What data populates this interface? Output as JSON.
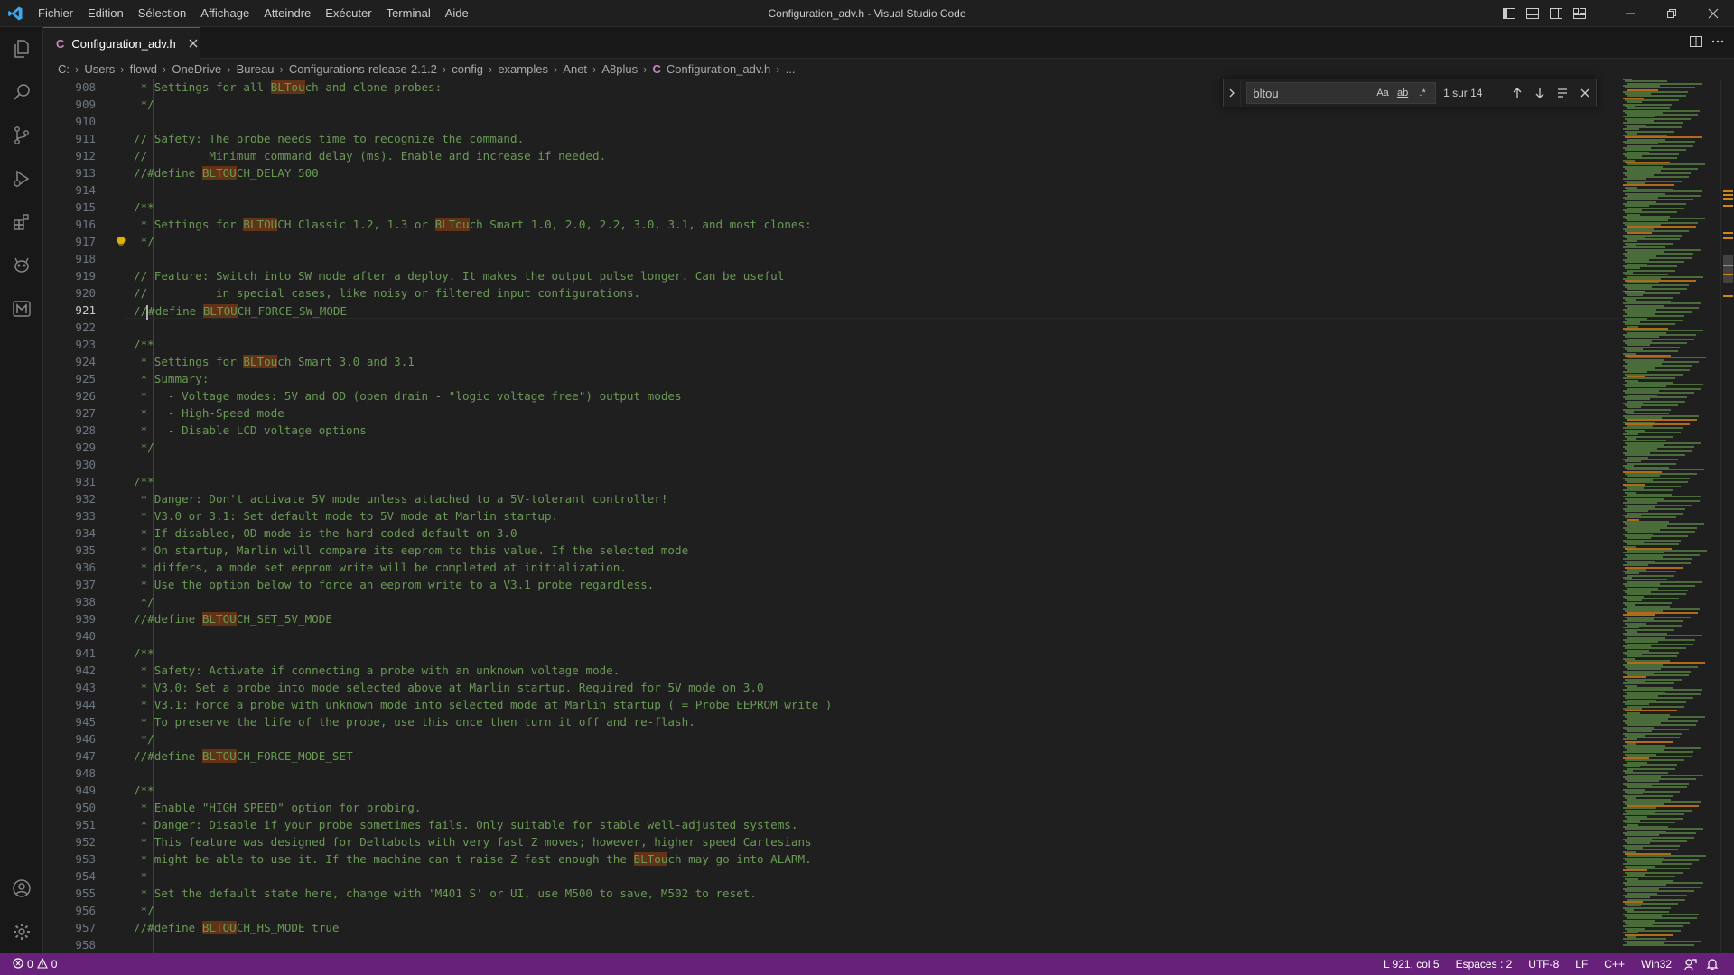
{
  "window": {
    "title": "Configuration_adv.h - Visual Studio Code",
    "menu": [
      "Fichier",
      "Edition",
      "Sélection",
      "Affichage",
      "Atteindre",
      "Exécuter",
      "Terminal",
      "Aide"
    ]
  },
  "tab": {
    "lang": "C",
    "label": "Configuration_adv.h"
  },
  "breadcrumb": {
    "items": [
      "C:",
      "Users",
      "flowd",
      "OneDrive",
      "Bureau",
      "Configurations-release-2.1.2",
      "config",
      "examples",
      "Anet",
      "A8plus"
    ],
    "file_lang": "C",
    "file": "Configuration_adv.h",
    "more": "..."
  },
  "find": {
    "value": "bltou",
    "match_case": "Aa",
    "whole_word": "ab",
    "regex": ".*",
    "count": "1 sur 14"
  },
  "editor": {
    "active_line": 921,
    "lines": [
      {
        "n": 908,
        "t": " * Settings for all ",
        "m": [
          "BLTou",
          "ch and clone probes:"
        ]
      },
      {
        "n": 909,
        "t": " */"
      },
      {
        "n": 910,
        "t": ""
      },
      {
        "n": 911,
        "t": "// Safety: The probe needs time to recognize the command."
      },
      {
        "n": 912,
        "t": "//         Minimum command delay (ms). Enable and increase if needed."
      },
      {
        "n": 913,
        "t": "//#define ",
        "m": [
          "BLTOU",
          "CH_DELAY 500"
        ]
      },
      {
        "n": 914,
        "t": ""
      },
      {
        "n": 915,
        "t": "/**"
      },
      {
        "n": 916,
        "t": " * Settings for ",
        "m": [
          "BLTOU",
          "CH Classic 1.2, 1.3 or ",
          "BLTou",
          "ch Smart 1.0, 2.0, 2.2, 3.0, 3.1, and most clones:"
        ]
      },
      {
        "n": 917,
        "t": " */"
      },
      {
        "n": 918,
        "t": ""
      },
      {
        "n": 919,
        "t": "// Feature: Switch into SW mode after a deploy. It makes the output pulse longer. Can be useful"
      },
      {
        "n": 920,
        "t": "//          in special cases, like noisy or filtered input configurations."
      },
      {
        "n": 921,
        "t": "//",
        "cursor": true,
        "m": [
          "",
          "#define "
        ],
        "m2": [
          "BLTOU",
          "CH_FORCE_SW_MODE"
        ]
      },
      {
        "n": 922,
        "t": ""
      },
      {
        "n": 923,
        "t": "/**"
      },
      {
        "n": 924,
        "t": " * Settings for ",
        "m": [
          "BLTou",
          "ch Smart 3.0 and 3.1"
        ]
      },
      {
        "n": 925,
        "t": " * Summary:"
      },
      {
        "n": 926,
        "t": " *   - Voltage modes: 5V and OD (open drain - \"logic voltage free\") output modes"
      },
      {
        "n": 927,
        "t": " *   - High-Speed mode"
      },
      {
        "n": 928,
        "t": " *   - Disable LCD voltage options"
      },
      {
        "n": 929,
        "t": " */"
      },
      {
        "n": 930,
        "t": ""
      },
      {
        "n": 931,
        "t": "/**"
      },
      {
        "n": 932,
        "t": " * Danger: Don't activate 5V mode unless attached to a 5V-tolerant controller!"
      },
      {
        "n": 933,
        "t": " * V3.0 or 3.1: Set default mode to 5V mode at Marlin startup."
      },
      {
        "n": 934,
        "t": " * If disabled, OD mode is the hard-coded default on 3.0"
      },
      {
        "n": 935,
        "t": " * On startup, Marlin will compare its eeprom to this value. If the selected mode"
      },
      {
        "n": 936,
        "t": " * differs, a mode set eeprom write will be completed at initialization."
      },
      {
        "n": 937,
        "t": " * Use the option below to force an eeprom write to a V3.1 probe regardless."
      },
      {
        "n": 938,
        "t": " */"
      },
      {
        "n": 939,
        "t": "//#define ",
        "m": [
          "BLTOU",
          "CH_SET_5V_MODE"
        ]
      },
      {
        "n": 940,
        "t": ""
      },
      {
        "n": 941,
        "t": "/**"
      },
      {
        "n": 942,
        "t": " * Safety: Activate if connecting a probe with an unknown voltage mode."
      },
      {
        "n": 943,
        "t": " * V3.0: Set a probe into mode selected above at Marlin startup. Required for 5V mode on 3.0"
      },
      {
        "n": 944,
        "t": " * V3.1: Force a probe with unknown mode into selected mode at Marlin startup ( = Probe EEPROM write )"
      },
      {
        "n": 945,
        "t": " * To preserve the life of the probe, use this once then turn it off and re-flash."
      },
      {
        "n": 946,
        "t": " */"
      },
      {
        "n": 947,
        "t": "//#define ",
        "m": [
          "BLTOU",
          "CH_FORCE_MODE_SET"
        ]
      },
      {
        "n": 948,
        "t": ""
      },
      {
        "n": 949,
        "t": "/**"
      },
      {
        "n": 950,
        "t": " * Enable \"HIGH SPEED\" option for probing."
      },
      {
        "n": 951,
        "t": " * Danger: Disable if your probe sometimes fails. Only suitable for stable well-adjusted systems."
      },
      {
        "n": 952,
        "t": " * This feature was designed for Deltabots with very fast Z moves; however, higher speed Cartesians"
      },
      {
        "n": 953,
        "t": " * might be able to use it. If the machine can't raise Z fast enough the ",
        "m": [
          "BLTou",
          "ch may go into ALARM."
        ]
      },
      {
        "n": 954,
        "t": " *"
      },
      {
        "n": 955,
        "t": " * Set the default state here, change with 'M401 S' or UI, use M500 to save, M502 to reset."
      },
      {
        "n": 956,
        "t": " */"
      },
      {
        "n": 957,
        "t": "//#define ",
        "m": [
          "BLTOU",
          "CH_HS_MODE true"
        ]
      },
      {
        "n": 958,
        "t": ""
      }
    ]
  },
  "statusbar": {
    "errors": "0",
    "warnings": "0",
    "position": "L 921, col 5",
    "spaces": "Espaces : 2",
    "encoding": "UTF-8",
    "eol": "LF",
    "language": "C++",
    "config": "Win32",
    "bg": "#68217a"
  },
  "colors": {
    "comment": "#6a9955",
    "match_highlight": "#623315",
    "tab_border": "#0078d4"
  }
}
